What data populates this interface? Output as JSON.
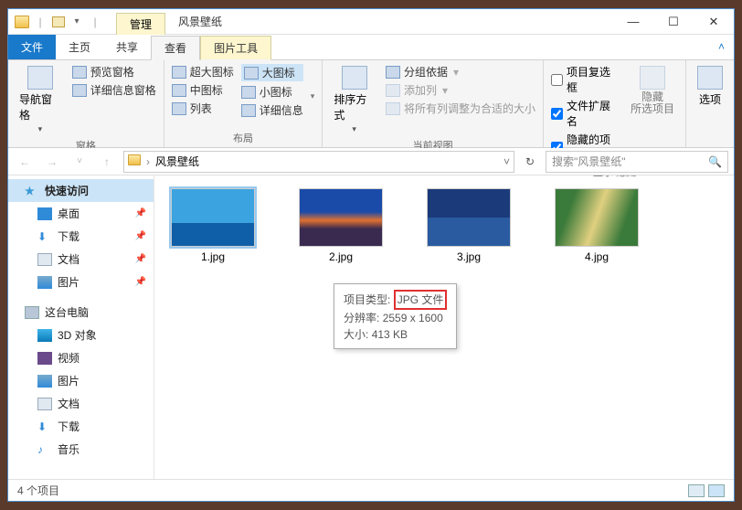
{
  "title_context": "管理",
  "window_title": "风景壁纸",
  "qatool": {
    "dropdown": "▾"
  },
  "wincontrols": {
    "min": "—",
    "max": "☐",
    "close": "✕"
  },
  "menu": {
    "file": "文件",
    "home": "主页",
    "share": "共享",
    "view": "查看",
    "picture_tools": "图片工具",
    "help": "˄"
  },
  "ribbon": {
    "panes": {
      "nav_pane": "导航窗格",
      "preview_pane": "预览窗格",
      "details_pane": "详细信息窗格",
      "group_label": "窗格"
    },
    "layout": {
      "extra_large": "超大图标",
      "large": "大图标",
      "medium": "中图标",
      "small": "小图标",
      "list": "列表",
      "details": "详细信息",
      "group_label": "布局"
    },
    "current_view": {
      "sort_by": "排序方式",
      "group_by": "分组依据",
      "add_columns": "添加列",
      "fit_columns": "将所有列调整为合适的大小",
      "group_label": "当前视图"
    },
    "show_hide": {
      "item_checkboxes": "项目复选框",
      "file_ext": "文件扩展名",
      "hidden_items": "隐藏的项目",
      "hide_selected": "隐藏\n所选项目",
      "group_label": "显示/隐藏"
    },
    "options": "选项"
  },
  "address": {
    "folder": "风景壁纸",
    "dropdown": "˅",
    "refresh": "↻"
  },
  "search_placeholder": "搜索\"风景壁纸\"",
  "nav": {
    "quick_access": "快速访问",
    "desktop": "桌面",
    "downloads": "下载",
    "documents": "文档",
    "pictures": "图片",
    "this_pc": "这台电脑",
    "objects_3d": "3D 对象",
    "videos": "视频",
    "pictures2": "图片",
    "documents2": "文档",
    "downloads2": "下载",
    "music": "音乐"
  },
  "files": [
    {
      "name": "1.jpg"
    },
    {
      "name": "2.jpg"
    },
    {
      "name": "3.jpg"
    },
    {
      "name": "4.jpg"
    }
  ],
  "tooltip": {
    "type_label": "项目类型:",
    "type_value": "JPG 文件",
    "res_label": "分辨率:",
    "res_value": "2559 x 1600",
    "size_label": "大小:",
    "size_value": "413 KB"
  },
  "status": "4 个项目"
}
